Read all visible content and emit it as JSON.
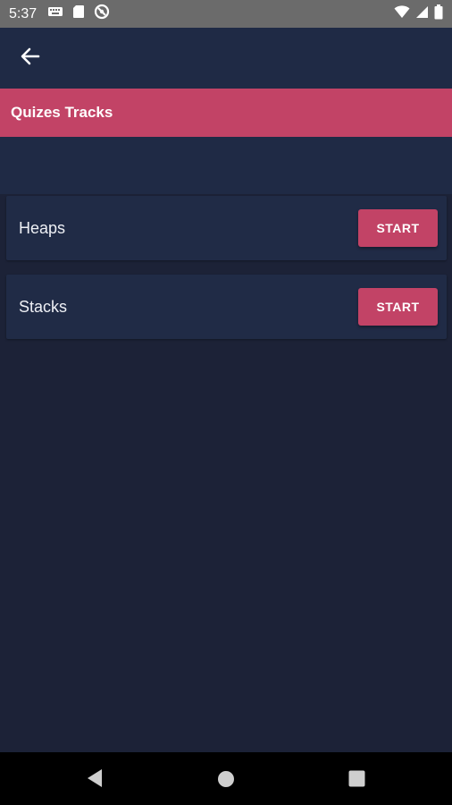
{
  "status_bar": {
    "time": "5:37",
    "left_icons": [
      "keyboard-icon",
      "sim-card-icon",
      "data-saver-icon"
    ],
    "right_icons": [
      "wifi-icon",
      "signal-icon",
      "battery-icon"
    ]
  },
  "app_bar": {
    "back_icon": "arrow-left-icon"
  },
  "section": {
    "title": "Quizes Tracks"
  },
  "tracks": [
    {
      "name": "Heaps",
      "button_label": "START"
    },
    {
      "name": "Stacks",
      "button_label": "START"
    }
  ],
  "nav_bar": {
    "icons": [
      "back-triangle-icon",
      "home-circle-icon",
      "recents-square-icon"
    ]
  },
  "colors": {
    "accent": "#c24366",
    "app_bar_bg": "#1f2a45",
    "background": "#1c2237",
    "card_bg": "#202b46"
  }
}
